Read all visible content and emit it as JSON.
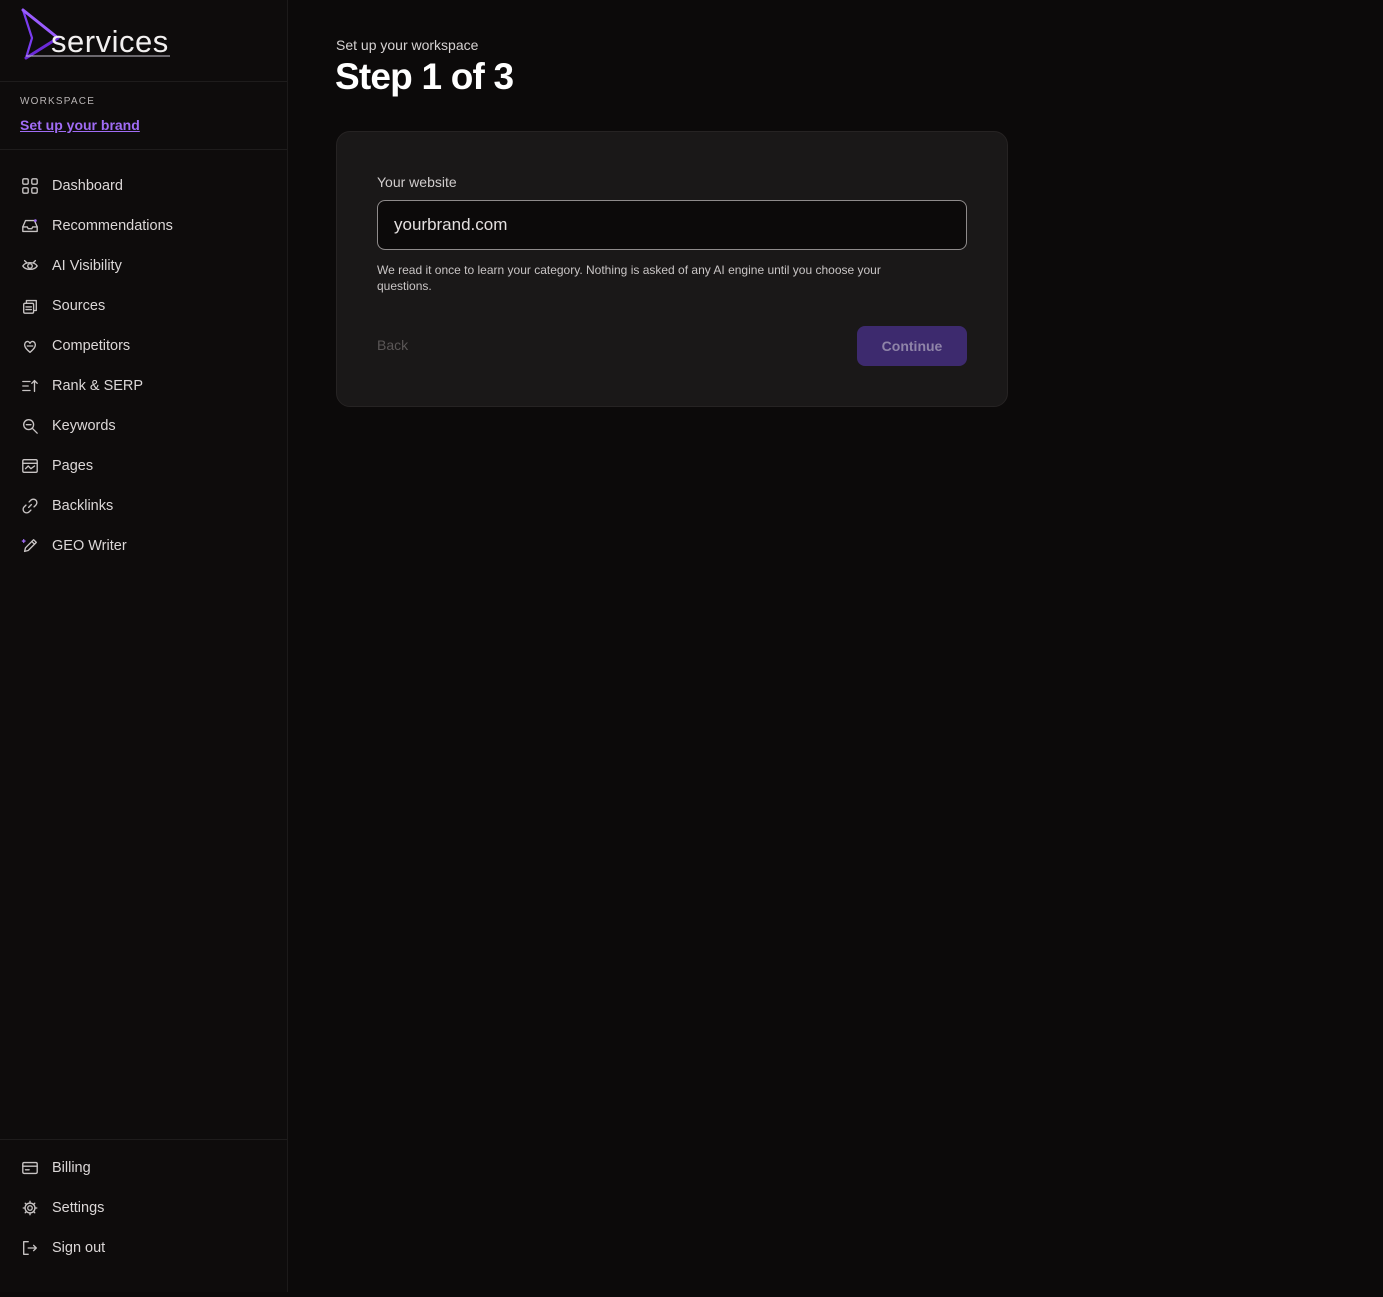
{
  "brand": {
    "logo_text": "services",
    "accent": "#a06cf5"
  },
  "workspace": {
    "label": "WORKSPACE",
    "link_label": "Set up your brand"
  },
  "sidebar": {
    "items": [
      {
        "label": "Dashboard",
        "icon": "dashboard-icon"
      },
      {
        "label": "Recommendations",
        "icon": "inbox-icon"
      },
      {
        "label": "AI Visibility",
        "icon": "eye-icon"
      },
      {
        "label": "Sources",
        "icon": "sources-icon"
      },
      {
        "label": "Competitors",
        "icon": "competitors-icon"
      },
      {
        "label": "Rank & SERP",
        "icon": "rank-icon"
      },
      {
        "label": "Keywords",
        "icon": "search-icon"
      },
      {
        "label": "Pages",
        "icon": "pages-icon"
      },
      {
        "label": "Backlinks",
        "icon": "link-icon"
      },
      {
        "label": "GEO Writer",
        "icon": "pen-icon"
      }
    ],
    "bottom_items": [
      {
        "label": "Billing",
        "icon": "card-icon"
      },
      {
        "label": "Settings",
        "icon": "gear-icon"
      },
      {
        "label": "Sign out",
        "icon": "sign-out-icon"
      }
    ]
  },
  "main": {
    "eyebrow": "Set up your workspace",
    "title": "Step 1 of 3",
    "form": {
      "website_label": "Your website",
      "website_value": "yourbrand.com",
      "help_text": "We read it once to learn your category. Nothing is asked of any AI engine until you choose your questions.",
      "back_label": "Back",
      "continue_label": "Continue"
    }
  }
}
